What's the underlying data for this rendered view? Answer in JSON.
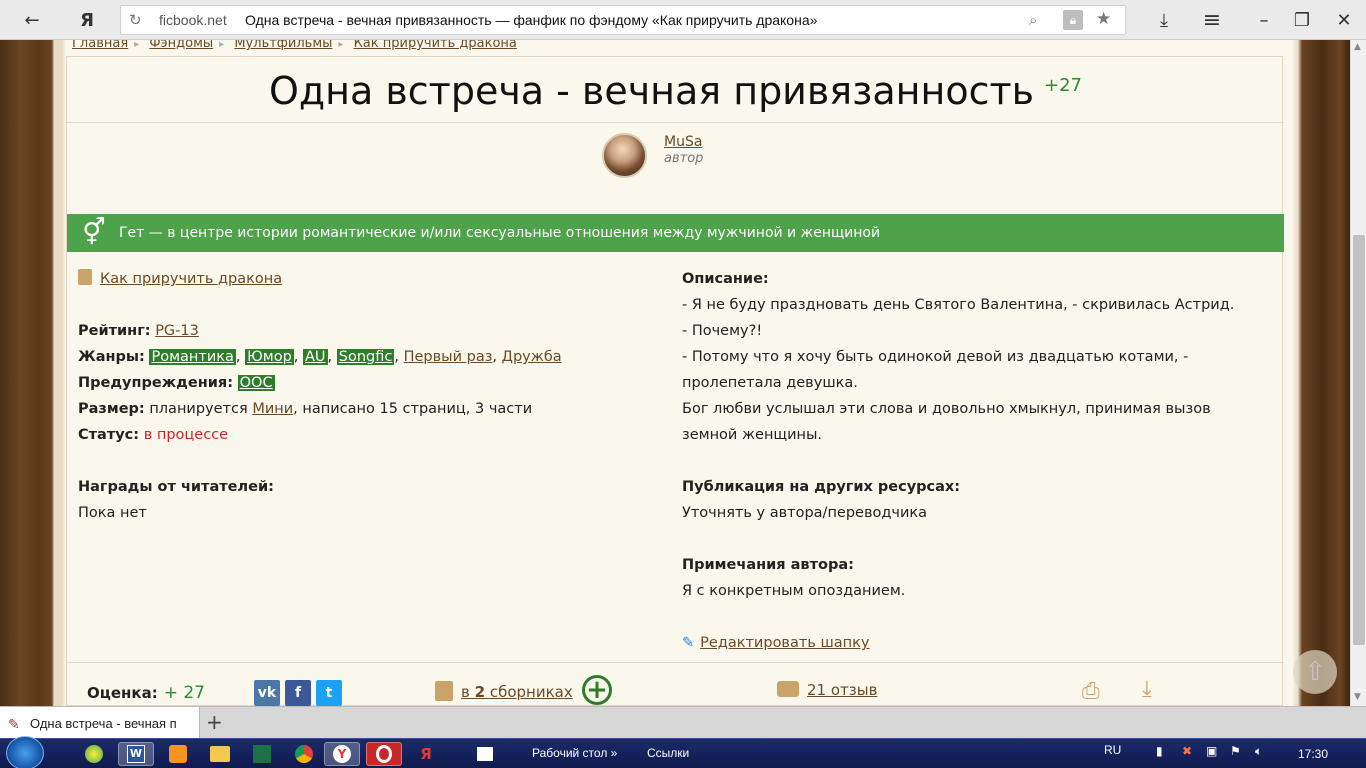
{
  "browser": {
    "back_label": "←",
    "yandex_label": "Я",
    "reload_icon": "↻",
    "domain": "ficbook.net",
    "page_title": "Одна встреча - вечная привязанность — фанфик по фэндому «Как приручить дракона»",
    "download_icon": "⤓",
    "menu_icon": "≡",
    "restore_icon": "❐",
    "close_icon": "✕"
  },
  "breadcrumbs": [
    "Главная",
    "Фэндомы",
    "Мультфильмы",
    "Как приручить дракона"
  ],
  "work": {
    "title": "Одна встреча - вечная привязанность",
    "score": "+27",
    "author_name": "MuSa",
    "author_role": "автор",
    "genre_band": "Гет — в центре истории романтические и/или сексуальные отношения между мужчиной и женщиной",
    "genre_band_color": "#4ea34a",
    "fandom": "Как приручить дракона"
  },
  "info": {
    "rating_label": "Рейтинг:",
    "rating_value": "PG-13",
    "genres_label": "Жанры:",
    "genres_tags": [
      "Романтика",
      "Юмор",
      "AU",
      "Songfic"
    ],
    "genres_links": [
      "Первый раз",
      "Дружба"
    ],
    "warnings_label": "Предупреждения:",
    "warnings_value": "OOC",
    "size_label": "Размер:",
    "size_prefix": "планируется",
    "size_value": "Мини",
    "size_suffix": ", написано 15 страниц, 3 части",
    "status_label": "Статус:",
    "status_value": "в процессе",
    "awards_label": "Награды от читателей:",
    "awards_value": "Пока нет"
  },
  "description": {
    "label": "Описание:",
    "lines": [
      "- Я не буду праздновать день Святого Валентина, - скривилась Астрид.",
      "- Почему?!",
      "- Потому что я хочу быть одинокой девой из двадцатью котами, -",
      "пролепетала девушка.",
      "Бог любви услышал эти слова и довольно хмыкнул, принимая вызов",
      "земной женщины."
    ],
    "publication_label": "Публикация на других ресурсах:",
    "publication_value": "Уточнять у автора/переводчика",
    "notes_label": "Примечания автора:",
    "notes_value": "Я с конкретным опозданием.",
    "edit_label": "Редактировать шапку"
  },
  "bottom": {
    "rating_label": "Оценка:",
    "rating_value": "+ 27",
    "social": [
      {
        "name": "vk",
        "glyph": "vk",
        "color": "#4a76a8"
      },
      {
        "name": "facebook",
        "glyph": "f",
        "color": "#3b5998"
      },
      {
        "name": "twitter",
        "glyph": "t",
        "color": "#1da1f2"
      }
    ],
    "collections_prefix": "в",
    "collections_count": "2",
    "collections_suffix": "сборниках",
    "add_icon": "+",
    "reviews": "21 отзыв"
  },
  "tabs": [
    {
      "label": "Одна встреча - вечная п"
    }
  ],
  "newtab_icon": "+",
  "taskbar": {
    "desktop_label": "Рабочий стол",
    "links_label": "Ссылки",
    "lang": "RU",
    "time": "17:30"
  }
}
